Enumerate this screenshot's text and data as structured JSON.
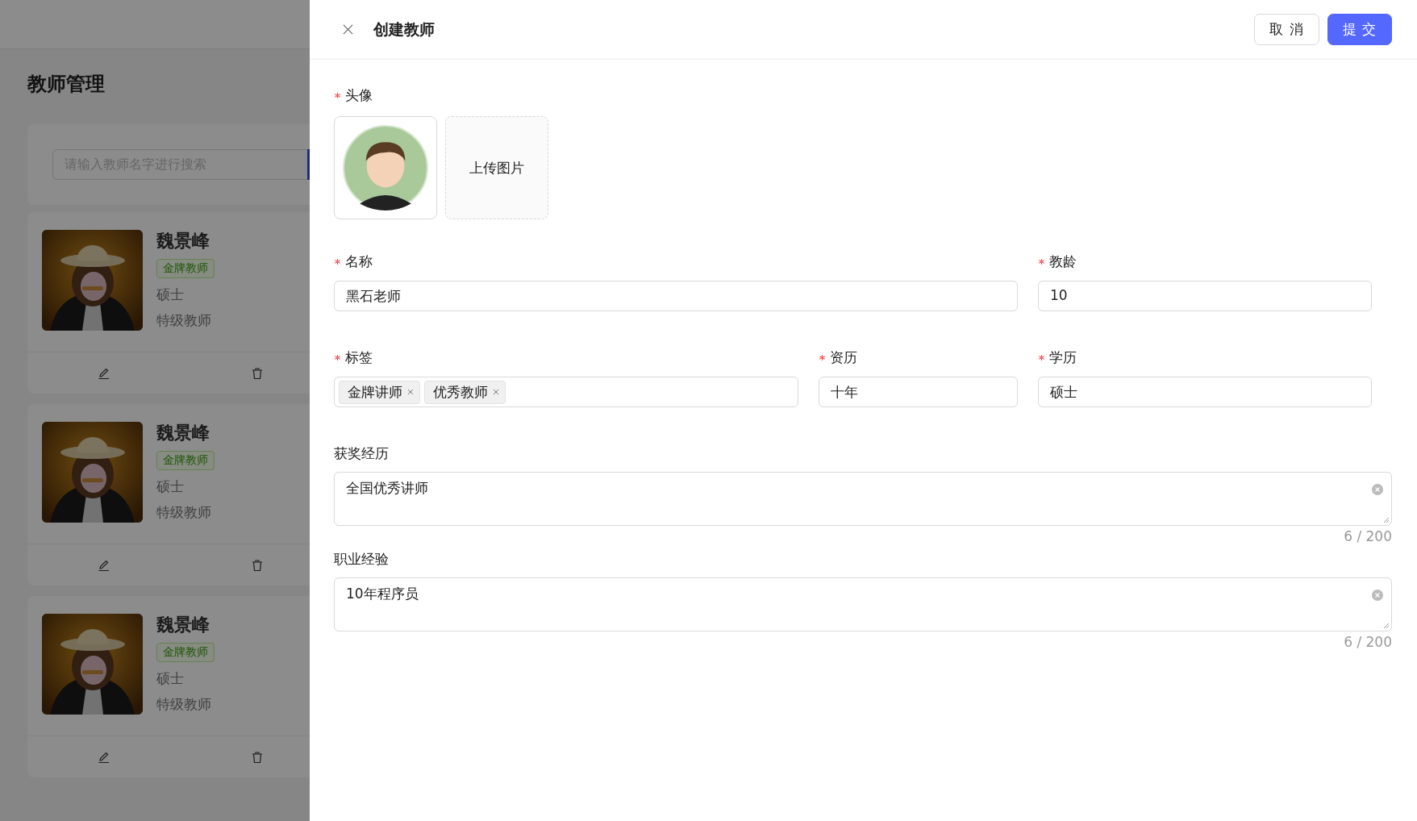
{
  "page": {
    "title": "教师管理",
    "search": {
      "placeholder": "请输入教师名字进行搜索"
    },
    "teachers": [
      {
        "name": "魏景峰",
        "tag": "金牌教师",
        "degree": "硕士",
        "rank": "特级教师"
      },
      {
        "name": "魏景峰",
        "tag": "金牌教师",
        "degree": "硕士",
        "rank": "特级教师"
      },
      {
        "name": "魏景峰",
        "tag": "金牌教师",
        "degree": "硕士",
        "rank": "特级教师"
      }
    ]
  },
  "drawer": {
    "title": "创建教师",
    "cancel": "取 消",
    "submit": "提 交",
    "avatar": {
      "label": "头像",
      "required": true,
      "upload": "上传图片"
    },
    "fields": [
      {
        "kind": "text",
        "label": "名称",
        "required": true,
        "value": "黑石老师"
      },
      {
        "kind": "text",
        "label": "教龄",
        "required": true,
        "value": "10"
      },
      {
        "kind": "tags",
        "label": "标签",
        "required": true,
        "tags": [
          "金牌讲师",
          "优秀教师"
        ]
      },
      {
        "kind": "text",
        "label": "资历",
        "required": true,
        "value": "十年"
      },
      {
        "kind": "text",
        "label": "学历",
        "required": true,
        "value": "硕士"
      },
      {
        "kind": "textarea",
        "label": "获奖经历",
        "value": "全国优秀讲师",
        "count": "6 / 200"
      },
      {
        "kind": "textarea",
        "label": "职业经验",
        "value": "10年程序员",
        "count": "6 / 200"
      }
    ]
  }
}
